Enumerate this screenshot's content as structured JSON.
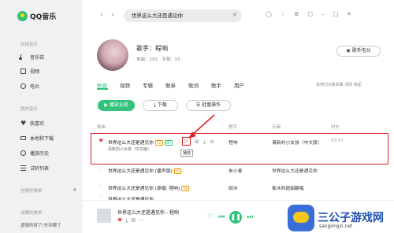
{
  "app": {
    "name": "QQ音乐"
  },
  "sidebar": {
    "sections": [
      {
        "title": "在线音乐",
        "items": [
          "音乐馆",
          "视频",
          "电台"
        ]
      },
      {
        "title": "我的音乐",
        "items": [
          "我喜欢",
          "本地和下载",
          "播放历史",
          "试听列表"
        ]
      }
    ],
    "created": "创建的歌单",
    "collected": "收藏的歌单",
    "collected_item": "遗憾的拼了!东到哪了"
  },
  "search": {
    "value": "世界这么大还是遇见你"
  },
  "artist": {
    "name": "歌手：程响",
    "songs_label": "单曲：193",
    "albums_label": "专辑：55",
    "radio_button": "歌手电台"
  },
  "tabs": [
    "歌曲",
    "视频",
    "专辑",
    "歌单",
    "歌词",
    "歌手",
    "用户"
  ],
  "search_meta": "找到150首单曲  清除  收起",
  "actions": {
    "play_all": "播放全部",
    "download": "下载",
    "batch": "批量操作"
  },
  "columns": {
    "title": "歌曲",
    "artist": "歌手",
    "album": "专辑",
    "duration": "时长"
  },
  "songs": [
    {
      "title": "世界这么大还是遇见你",
      "sub": "清新的小女孩（中文版）",
      "artist": "程响",
      "album": "清新的小女孩（中文版）",
      "duration": "03:57",
      "liked": "true"
    },
    {
      "title": "世界这么大还是遇见你 (童声版)",
      "sub": "",
      "artist": "朱小睿",
      "album": "世界这么大还是遇见你",
      "duration": "",
      "liked": "false"
    },
    {
      "title": "世界这么大还是遇见你 (原唱: 程响)",
      "sub": "",
      "artist": "颜沐",
      "album": "紫沐的超甜翻唱",
      "duration": "",
      "liked": "false"
    },
    {
      "title": "世界这么大还是遇见你",
      "sub": "",
      "artist": "",
      "album": "",
      "duration": "",
      "liked": "false"
    }
  ],
  "tooltip": "播放",
  "player": {
    "title": "世界这么大还是遇见你 - 程响"
  },
  "watermark": {
    "name": "三公子游戏网",
    "url": "sangongzi.net"
  },
  "colors": {
    "accent": "#31c27c",
    "highlight": "#e0222b"
  }
}
